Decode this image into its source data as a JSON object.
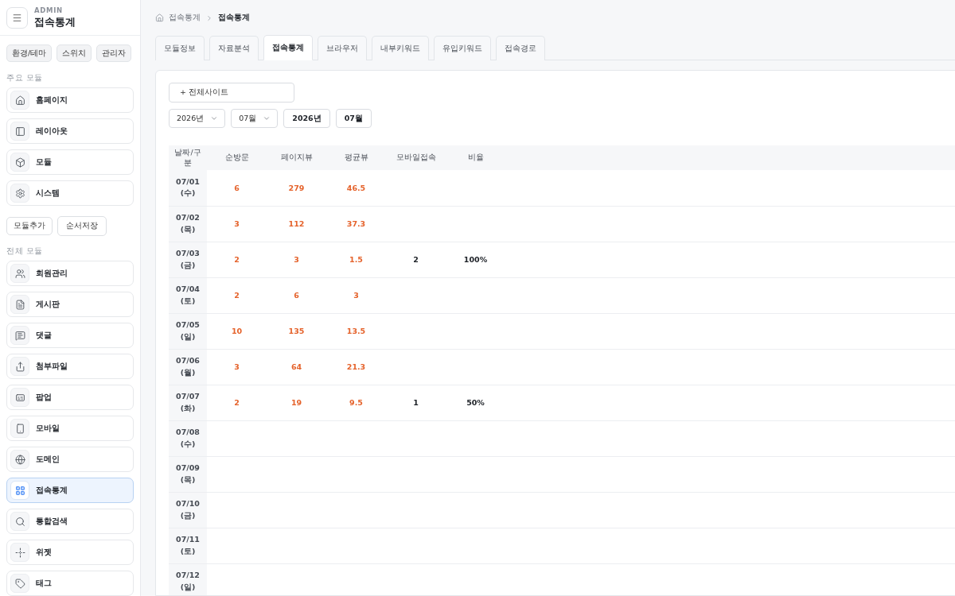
{
  "sidebar": {
    "overline": "ADMIN",
    "title": "접속통계",
    "top_buttons": [
      "환경/테마",
      "스위치",
      "관리자"
    ],
    "main_modules": {
      "heading": "주요 모듈",
      "items": [
        {
          "label": "홈페이지",
          "selected": false
        },
        {
          "label": "레이아웃",
          "selected": false
        },
        {
          "label": "모듈",
          "selected": false
        },
        {
          "label": "시스템",
          "selected": false
        }
      ]
    },
    "module_buttons": [
      "모듈추가",
      "순서저장"
    ],
    "all_modules": {
      "heading": "전체 모듈",
      "items": [
        {
          "label": "회원관리",
          "selected": false
        },
        {
          "label": "게시판",
          "selected": false
        },
        {
          "label": "댓글",
          "selected": false
        },
        {
          "label": "첨부파일",
          "selected": false
        },
        {
          "label": "팝업",
          "selected": false
        },
        {
          "label": "모바일",
          "selected": false
        },
        {
          "label": "도메인",
          "selected": false
        },
        {
          "label": "접속통계",
          "selected": true
        },
        {
          "label": "통합검색",
          "selected": false
        },
        {
          "label": "위젯",
          "selected": false
        },
        {
          "label": "태그",
          "selected": false
        }
      ]
    }
  },
  "breadcrumb": [
    "접속통계",
    "접속통계"
  ],
  "tabs": [
    {
      "label": "모듈정보",
      "selected": false
    },
    {
      "label": "자료분석",
      "selected": false
    },
    {
      "label": "접속통계",
      "selected": true
    },
    {
      "label": "브라우저",
      "selected": false
    },
    {
      "label": "내부키워드",
      "selected": false
    },
    {
      "label": "유입키워드",
      "selected": false
    },
    {
      "label": "접속경로",
      "selected": false
    }
  ],
  "filters": {
    "site_button": "+ 전체사이트",
    "year_select": "2026년",
    "month_select": "07월",
    "year_button": "2026년",
    "month_button": "07월"
  },
  "table": {
    "columns": [
      "날짜/구분",
      "순방문",
      "페이지뷰",
      "평균뷰",
      "모바일접속",
      "비율"
    ],
    "rows": [
      {
        "date": "07/01 (수)",
        "visits": "6",
        "pageviews": "279",
        "average": "46.5"
      },
      {
        "date": "07/02 (목)",
        "visits": "3",
        "pageviews": "112",
        "average": "37.3"
      },
      {
        "date": "07/03 (금)",
        "visits": "2",
        "pageviews": "3",
        "average": "1.5",
        "mobile": "2",
        "ratio": "100%"
      },
      {
        "date": "07/04 (토)",
        "visits": "2",
        "pageviews": "6",
        "average": "3"
      },
      {
        "date": "07/05 (일)",
        "visits": "10",
        "pageviews": "135",
        "average": "13.5"
      },
      {
        "date": "07/06 (월)",
        "visits": "3",
        "pageviews": "64",
        "average": "21.3"
      },
      {
        "date": "07/07 (화)",
        "visits": "2",
        "pageviews": "19",
        "average": "9.5",
        "mobile": "1",
        "ratio": "50%"
      },
      {
        "date": "07/08 (수)"
      },
      {
        "date": "07/09 (목)"
      },
      {
        "date": "07/10 (금)"
      },
      {
        "date": "07/11 (토)"
      },
      {
        "date": "07/12 (일)"
      }
    ]
  }
}
